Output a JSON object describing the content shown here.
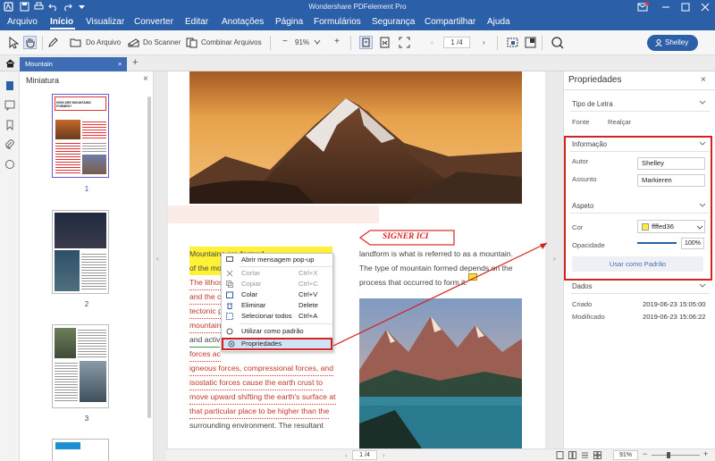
{
  "app": {
    "title": "Wondershare PDFelement Pro"
  },
  "menu": [
    "Arquivo",
    "Início",
    "Visualizar",
    "Converter",
    "Editar",
    "Anotações",
    "Página",
    "Formulários",
    "Segurança",
    "Compartilhar",
    "Ajuda"
  ],
  "toolbar": {
    "from_file": "Do Arquivo",
    "from_scanner": "Do Scanner",
    "combine": "Combinar Arquivos",
    "zoom": "91%",
    "page_indicator": "1 /4",
    "user": "Shelley"
  },
  "tab": {
    "label": "Mountain"
  },
  "thumbnails": {
    "title": "Miniatura",
    "pages": [
      "1",
      "2",
      "3"
    ],
    "page1_heading": "HOW ARE MOUNTAINS FORMED?"
  },
  "document": {
    "callout": "SIGNER ICI",
    "left_column": [
      "Mountains are formed",
      "of the mo",
      "The lithos",
      "and the c",
      "tectonic p",
      "mountain",
      "and activ",
      "forces ac",
      "igneous forces, compressional forces, and",
      "isostatic forces cause the earth crust to",
      "move upward shifting the earth's surface at",
      "that particular place to be higher than the",
      "surrounding environment.  The resultant"
    ],
    "right_column": [
      "landform is what is referred to as a mountain.",
      "The type of mountain formed depends on the",
      "process that occurred to form it."
    ]
  },
  "context_menu": {
    "items": [
      {
        "label": "Abrir mensagem pop-up",
        "shortcut": "",
        "disabled": false
      },
      {
        "label": "Cortar",
        "shortcut": "Ctrl+X",
        "disabled": true
      },
      {
        "label": "Copiar",
        "shortcut": "Ctrl+C",
        "disabled": true
      },
      {
        "label": "Colar",
        "shortcut": "Ctrl+V",
        "disabled": false
      },
      {
        "label": "Eliminar",
        "shortcut": "Delete",
        "disabled": false
      },
      {
        "label": "Selecionar todos",
        "shortcut": "Ctrl+A",
        "disabled": false
      },
      {
        "label": "Utilizar como padrão",
        "shortcut": "",
        "disabled": false
      },
      {
        "label": "Propriedades",
        "shortcut": "",
        "disabled": false
      }
    ]
  },
  "properties": {
    "title": "Propriedades",
    "font_section": "Tipo de Letra",
    "font_tab": "Fonte",
    "highlight_tab": "Realçar",
    "info_section": "Informação",
    "author_label": "Autor",
    "author_value": "Shelley",
    "subject_label": "Assunto",
    "subject_value": "Markieren",
    "appearance_section": "Aspeto",
    "color_label": "Cor",
    "color_value": "ffffed36",
    "color_swatch": "#ffed36",
    "opacity_label": "Opacidade",
    "opacity_value": "100%",
    "default_button": "Usar como Padrão",
    "data_section": "Dados",
    "created_label": "Criado",
    "created_value": "2019-06-23 15:05:00",
    "modified_label": "Modificado",
    "modified_value": "2019-06-23 15:06:22"
  },
  "statusbar": {
    "page": "1 /4",
    "zoom": "91%"
  },
  "colors": {
    "brand": "#2b5fa8",
    "highlight": "#fff236",
    "annotation_red": "#d32222"
  }
}
